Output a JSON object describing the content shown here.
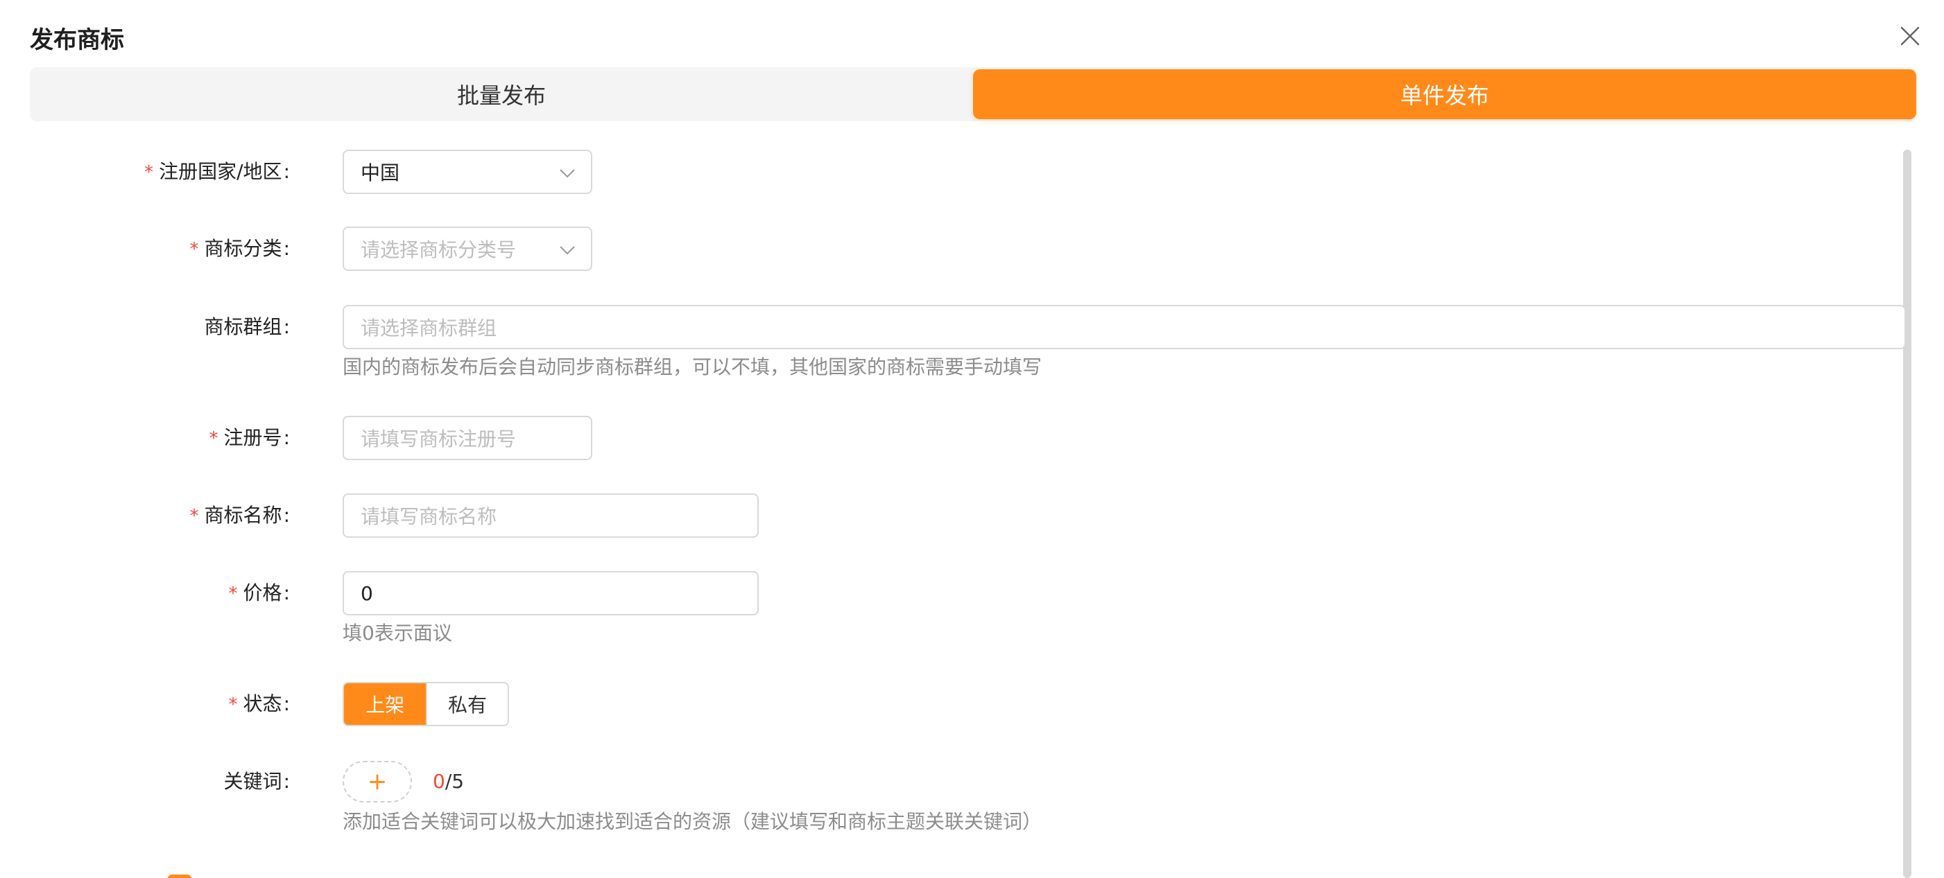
{
  "dialog": {
    "title": "发布商标",
    "tabs": [
      {
        "label": "批量发布",
        "active": false
      },
      {
        "label": "单件发布",
        "active": true
      }
    ]
  },
  "form": {
    "colon": ":",
    "required_mark": "*",
    "country": {
      "label": "注册国家/地区",
      "value": "中国",
      "required": true
    },
    "category": {
      "label": "商标分类",
      "placeholder": "请选择商标分类号",
      "required": true
    },
    "group": {
      "label": "商标群组",
      "placeholder": "请选择商标群组",
      "hint": "国内的商标发布后会自动同步商标群组，可以不填，其他国家的商标需要手动填写",
      "required": false
    },
    "reg_no": {
      "label": "注册号",
      "placeholder": "请填写商标注册号",
      "required": true
    },
    "name": {
      "label": "商标名称",
      "placeholder": "请填写商标名称",
      "required": true
    },
    "price": {
      "label": "价格",
      "value": "0",
      "hint": "填0表示面议",
      "required": true
    },
    "status": {
      "label": "状态",
      "options": [
        "上架",
        "私有"
      ],
      "selected": "上架",
      "required": true
    },
    "keywords": {
      "label": "关键词",
      "add_symbol": "+",
      "count_current": "0",
      "count_max": "/5",
      "hint": "添加适合关键词可以极大加速找到适合的资源（建议填写和商标主题关联关键词）",
      "required": false
    }
  },
  "colors": {
    "accent": "#ff8a1a",
    "required": "#f5463a",
    "hint": "#8c8c8c",
    "placeholder": "#bdbdbd"
  },
  "icons": {
    "close": "close-icon",
    "dropdown": "chevron-down-icon",
    "checkbox": "checkbox-checked-icon"
  }
}
